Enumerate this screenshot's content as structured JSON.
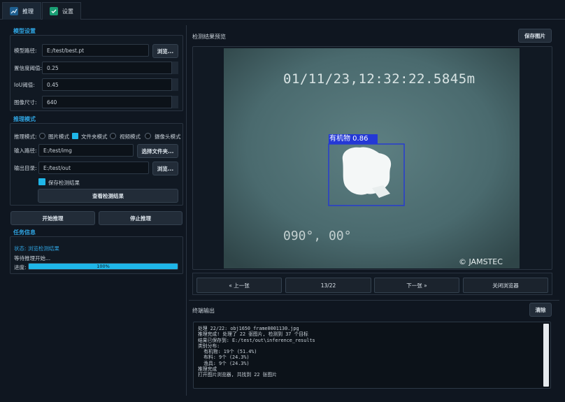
{
  "tabs": [
    {
      "label": "推理",
      "icon": "chart-icon",
      "active": true
    },
    {
      "label": "设置",
      "icon": "check-icon",
      "active": false
    }
  ],
  "model_settings": {
    "title": "模型设置",
    "model_path": {
      "label": "模型路径:",
      "value": "E:/test/best.pt",
      "browse": "浏览..."
    },
    "conf_threshold": {
      "label": "置信度阈值:",
      "value": "0.25"
    },
    "iou_threshold": {
      "label": "IoU阈值:",
      "value": "0.45"
    },
    "image_size": {
      "label": "图像尺寸:",
      "value": "640"
    }
  },
  "inference_mode": {
    "title": "推理模式",
    "mode_label": "推理模式:",
    "options": [
      "图片模式",
      "文件夹模式",
      "视频模式",
      "摄像头模式"
    ],
    "selected": 1,
    "input_path": {
      "label": "输入路径:",
      "value": "E:/test/img",
      "button": "选择文件夹..."
    },
    "output_dir": {
      "label": "输出目录:",
      "value": "E:/test/out",
      "button": "浏览..."
    },
    "save_results": {
      "label": "保存检测结果",
      "checked": true
    },
    "view_results": "查看检测结果"
  },
  "actions": {
    "start": "开始推理",
    "stop": "停止推理"
  },
  "task_info": {
    "title": "任务信息",
    "status": "状态: 浏览检测结果",
    "waiting": "等待推理开始...",
    "progress_label": "进度:",
    "progress_text": "100%",
    "progress_value": 1.0
  },
  "preview": {
    "title": "检测结果预览",
    "save_button": "保存图片",
    "image": {
      "timestamp": "01/11/23,12:32:22.5845m",
      "heading": "090°, 00°",
      "watermark": "© JAMSTEC",
      "detection_label": "有机物 0.86"
    }
  },
  "navigation": {
    "prev": "« 上一张",
    "counter": "13/22",
    "next": "下一张 »",
    "close": "关闭浏览器"
  },
  "terminal": {
    "title": "终端输出",
    "clear": "清除",
    "lines": [
      "处理 22/22: obj1650_frame0001130.jpg",
      "推理完成! 处理了 22 张图片, 检测到 37 个目标",
      "结果已保存到: E:/test/out\\inference_results",
      "类别分布:",
      "  有机物: 19个 (51.4%)",
      "  布料: 9个 (24.3%)",
      "  渔具: 9个 (24.3%)",
      "推理完成",
      "打开图片浏览器, 共找到 22 张图片"
    ]
  },
  "colors": {
    "accent": "#1fb6e8",
    "section_title": "#2fa3e0",
    "detection_box": "#2438d6"
  }
}
